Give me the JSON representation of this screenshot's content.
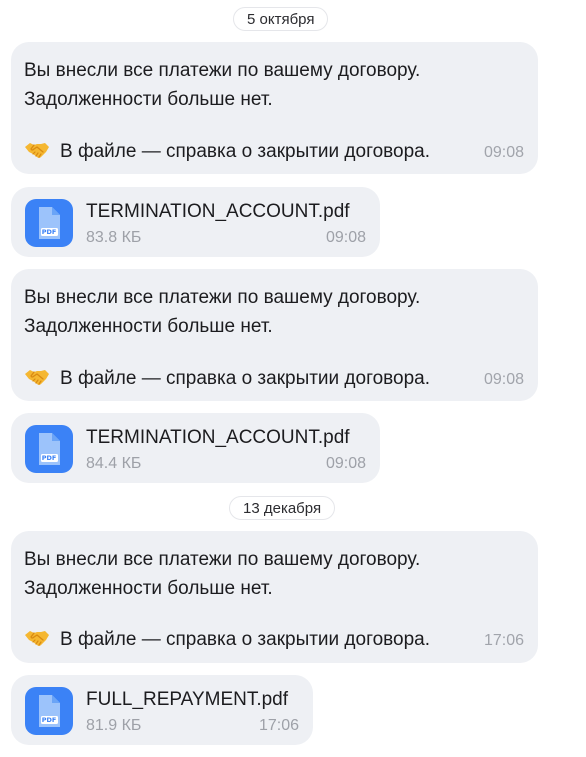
{
  "dates": [
    "5 октября",
    "13 декабря"
  ],
  "messages": [
    {
      "line1": "Вы внесли все платежи по вашему договору.",
      "line2": "Задолженности больше нет.",
      "footer": "В файле — справка о закрытии договора.",
      "icon": "handshake-icon",
      "time": "09:08"
    },
    {
      "line1": "Вы внесли все платежи по вашему договору.",
      "line2": "Задолженности больше нет.",
      "footer": "В файле — справка о закрытии договора.",
      "icon": "handshake-icon",
      "time": "09:08"
    },
    {
      "line1": "Вы внесли все платежи по вашему договору.",
      "line2": "Задолженности больше нет.",
      "footer": "В файле — справка о закрытии договора.",
      "icon": "handshake-icon",
      "time": "17:06"
    }
  ],
  "files": [
    {
      "name": "TERMINATION_ACCOUNT.pdf",
      "size": "83.8 КБ",
      "time": "09:08",
      "icon_label": "PDF"
    },
    {
      "name": "TERMINATION_ACCOUNT.pdf",
      "size": "84.4 КБ",
      "time": "09:08",
      "icon_label": "PDF"
    },
    {
      "name": "FULL_REPAYMENT.pdf",
      "size": "81.9 КБ",
      "time": "17:06",
      "icon_label": "PDF"
    }
  ],
  "colors": {
    "bubble_bg": "#eef0f4",
    "pdf_icon": "#3b82f6",
    "time_gray": "#a1a4ab",
    "handshake": "#f5b731"
  }
}
